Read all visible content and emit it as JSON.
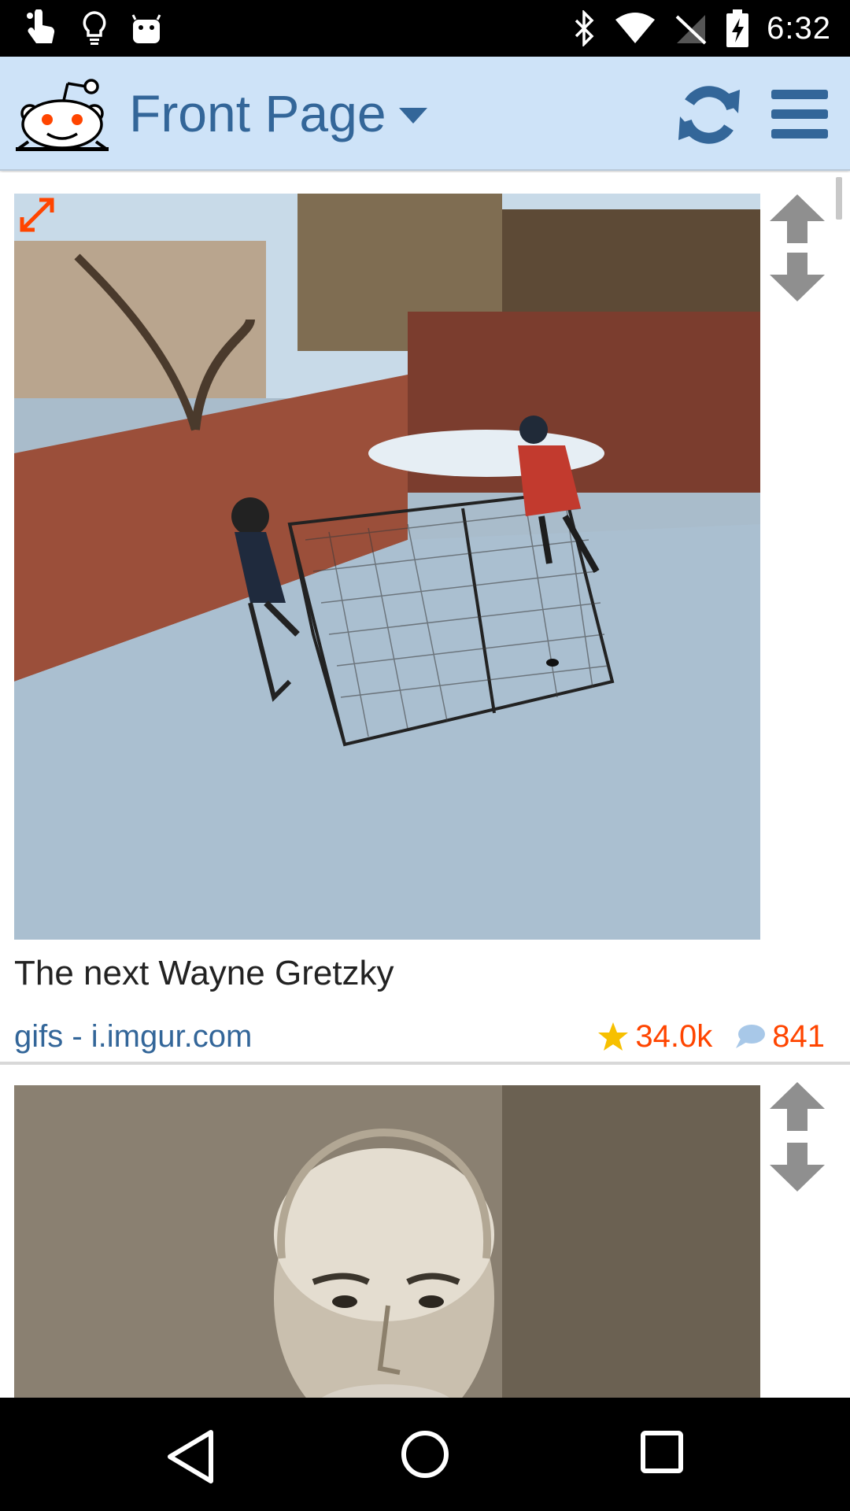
{
  "status_bar": {
    "time": "6:32",
    "icons_left": [
      "touch-icon",
      "lightbulb-icon",
      "android-icon"
    ],
    "icons_right": [
      "bluetooth-icon",
      "wifi-icon",
      "no-signal-icon",
      "battery-charging-icon"
    ]
  },
  "header": {
    "title": "Front Page",
    "logo": "reddit-alien-logo",
    "actions": [
      "refresh-icon",
      "menu-icon"
    ],
    "background": "#cee3f8",
    "accent": "#336699"
  },
  "posts": [
    {
      "title": "The next Wayne Gretzky",
      "source": "gifs - i.imgur.com",
      "score": "34.0k",
      "comments": "841",
      "thumbnail": "backyard-ice-rink-hockey-gif",
      "expand_icon": "expand-arrows-icon"
    },
    {
      "thumbnail": "sepia-portrait-old-man"
    }
  ],
  "colors": {
    "score": "#ff4500",
    "source": "#336699",
    "vote_arrows": "#8f8f8f"
  },
  "nav_bar": {
    "buttons": [
      "back-icon",
      "home-icon",
      "recents-icon"
    ]
  }
}
